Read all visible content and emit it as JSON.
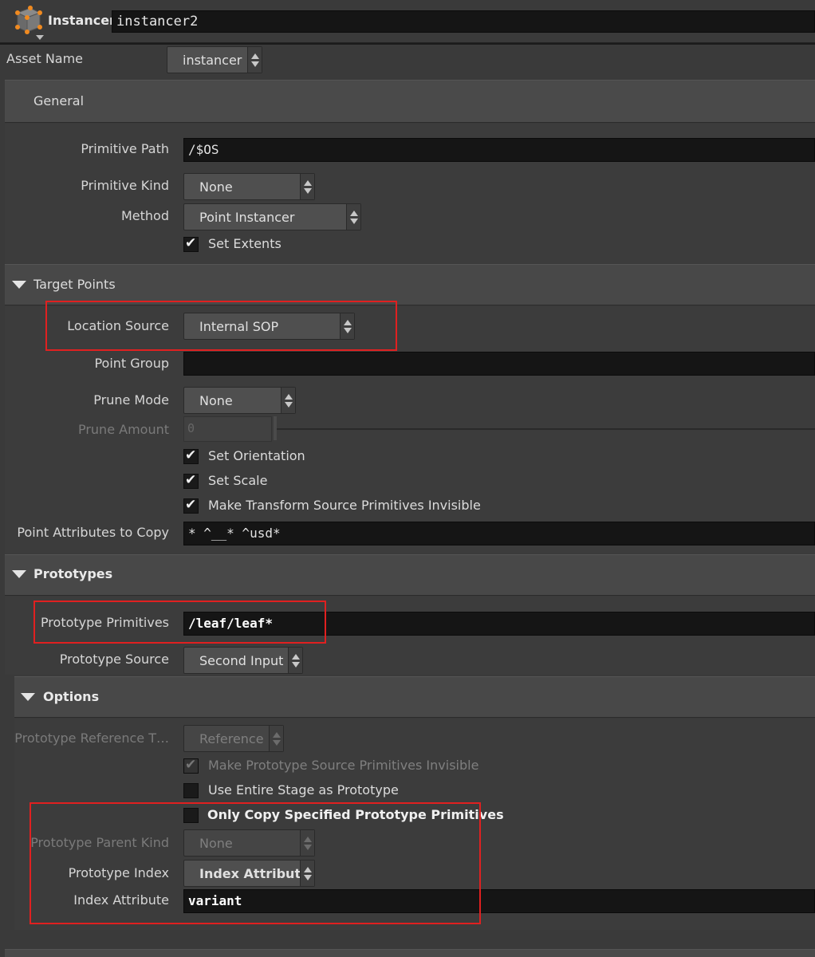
{
  "header": {
    "node_type": "Instancer",
    "node_name": "instancer2"
  },
  "asset": {
    "label": "Asset Name",
    "value": "instancer"
  },
  "general": {
    "title": "General",
    "primitive_path": {
      "label": "Primitive Path",
      "value": "/$OS"
    },
    "primitive_kind": {
      "label": "Primitive Kind",
      "value": "None"
    },
    "method": {
      "label": "Method",
      "value": "Point Instancer"
    },
    "set_extents": {
      "label": "Set Extents",
      "checked": true
    }
  },
  "target_points": {
    "title": "Target Points",
    "location_source": {
      "label": "Location Source",
      "value": "Internal SOP"
    },
    "point_group": {
      "label": "Point Group",
      "value": ""
    },
    "prune_mode": {
      "label": "Prune Mode",
      "value": "None"
    },
    "prune_amount": {
      "label": "Prune Amount",
      "value": "0"
    },
    "set_orientation": {
      "label": "Set Orientation",
      "checked": true
    },
    "set_scale": {
      "label": "Set Scale",
      "checked": true
    },
    "make_invisible": {
      "label": "Make Transform Source Primitives Invisible",
      "checked": true
    },
    "point_attributes": {
      "label": "Point Attributes to Copy",
      "value": "* ^__* ^usd*"
    }
  },
  "prototypes": {
    "title": "Prototypes",
    "prototype_primitives": {
      "label": "Prototype Primitives",
      "value": "/leaf/leaf*"
    },
    "prototype_source": {
      "label": "Prototype Source",
      "value": "Second Input"
    }
  },
  "options": {
    "title": "Options",
    "reference_type": {
      "label": "Prototype Reference T…",
      "value": "Reference"
    },
    "make_proto_invisible": {
      "label": "Make Prototype Source Primitives Invisible",
      "checked": true
    },
    "use_entire_stage": {
      "label": "Use Entire Stage as Prototype",
      "checked": false
    },
    "only_copy_specified": {
      "label": "Only Copy Specified Prototype Primitives",
      "checked": false
    },
    "parent_kind": {
      "label": "Prototype Parent Kind",
      "value": "None"
    },
    "prototype_index": {
      "label": "Prototype Index",
      "value": "Index Attribute"
    },
    "index_attribute": {
      "label": "Index Attribute",
      "value": "variant"
    }
  },
  "colors": {
    "highlight": "#e02020",
    "background": "#3a3a3a",
    "field": "#151515"
  }
}
